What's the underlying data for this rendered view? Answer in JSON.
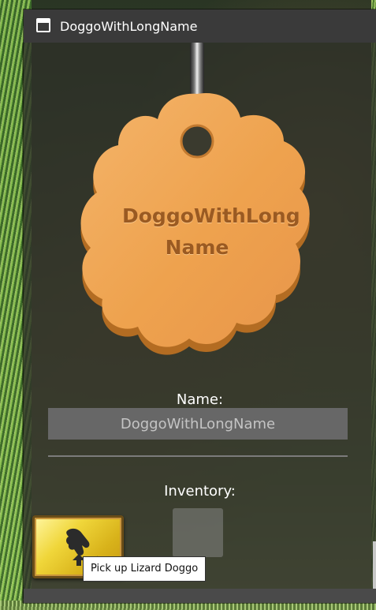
{
  "window": {
    "title": "DoggoWithLongName"
  },
  "tag": {
    "name": "DoggoWithLong Name",
    "color": "#eea24e"
  },
  "name_field": {
    "label": "Name:",
    "value": "DoggoWithLongName"
  },
  "inventory": {
    "label": "Inventory:",
    "slots": [
      {
        "item": ""
      }
    ]
  },
  "action": {
    "icon": "pickup-hand-icon",
    "tooltip": "Pick up Lizard Doggo"
  },
  "colors": {
    "titlebar": "#3a3a3a",
    "button_accent": "#f0d63a",
    "tag_text": "#9a5a22"
  }
}
